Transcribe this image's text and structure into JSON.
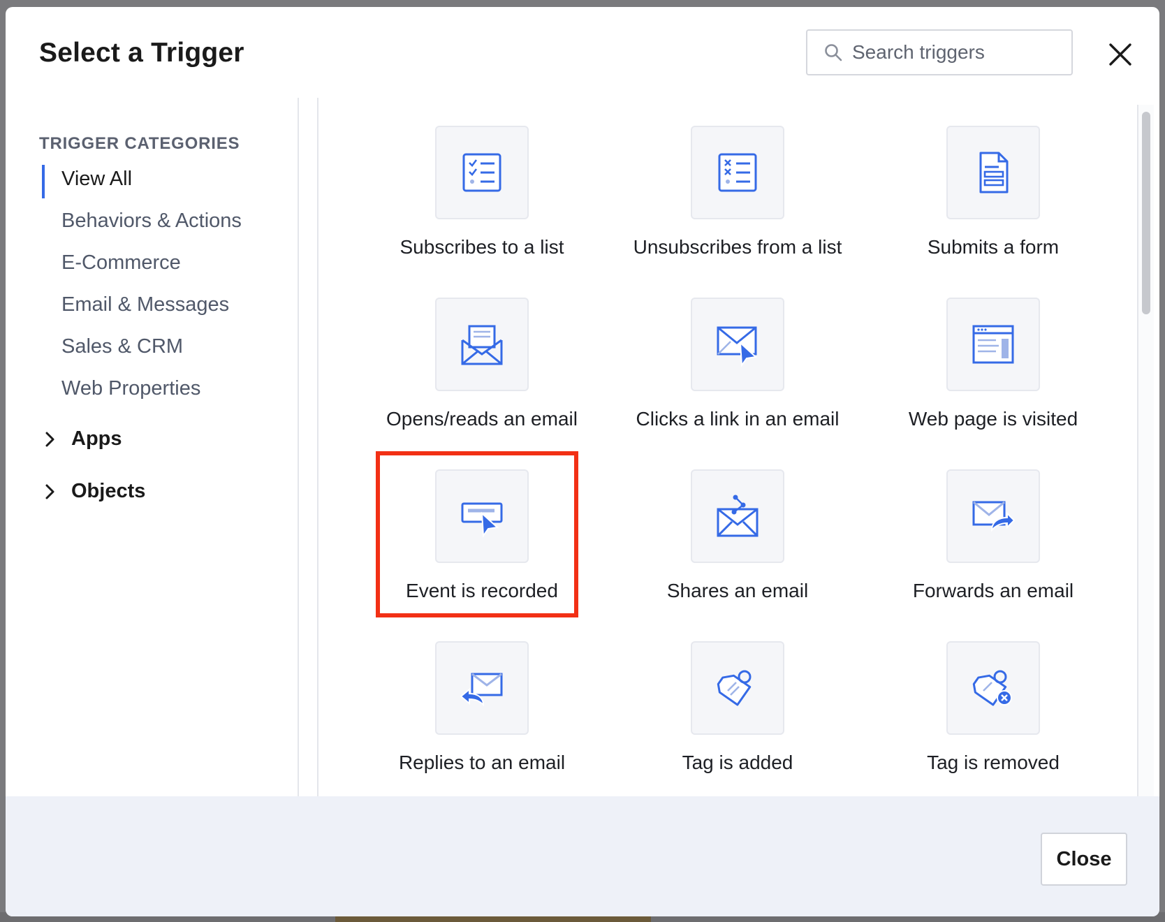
{
  "modal": {
    "title": "Select a Trigger",
    "search": {
      "placeholder": "Search triggers",
      "value": ""
    }
  },
  "sidebar": {
    "heading": "TRIGGER CATEGORIES",
    "categories": [
      {
        "label": "View All",
        "active": true
      },
      {
        "label": "Behaviors & Actions",
        "active": false
      },
      {
        "label": "E-Commerce",
        "active": false
      },
      {
        "label": "Email & Messages",
        "active": false
      },
      {
        "label": "Sales & CRM",
        "active": false
      },
      {
        "label": "Web Properties",
        "active": false
      }
    ],
    "groups": [
      {
        "label": "Apps"
      },
      {
        "label": "Objects"
      }
    ]
  },
  "triggers": [
    {
      "label": "Subscribes to a list",
      "icon": "subscribe-list-icon"
    },
    {
      "label": "Unsubscribes from a list",
      "icon": "unsubscribe-list-icon"
    },
    {
      "label": "Submits a form",
      "icon": "form-document-icon"
    },
    {
      "label": "Opens/reads an email",
      "icon": "open-email-icon"
    },
    {
      "label": "Clicks a link in an email",
      "icon": "email-click-icon"
    },
    {
      "label": "Web page is visited",
      "icon": "web-page-icon"
    },
    {
      "label": "Event is recorded",
      "icon": "event-cursor-icon",
      "highlighted": true
    },
    {
      "label": "Shares an email",
      "icon": "share-email-icon"
    },
    {
      "label": "Forwards an email",
      "icon": "forward-email-icon"
    },
    {
      "label": "Replies to an email",
      "icon": "reply-email-icon"
    },
    {
      "label": "Tag is added",
      "icon": "tag-add-icon"
    },
    {
      "label": "Tag is removed",
      "icon": "tag-remove-icon"
    }
  ],
  "footer": {
    "close_label": "Close"
  },
  "colors": {
    "accent": "#356ae6",
    "highlight": "#f23015",
    "icon": "#356ae6"
  }
}
